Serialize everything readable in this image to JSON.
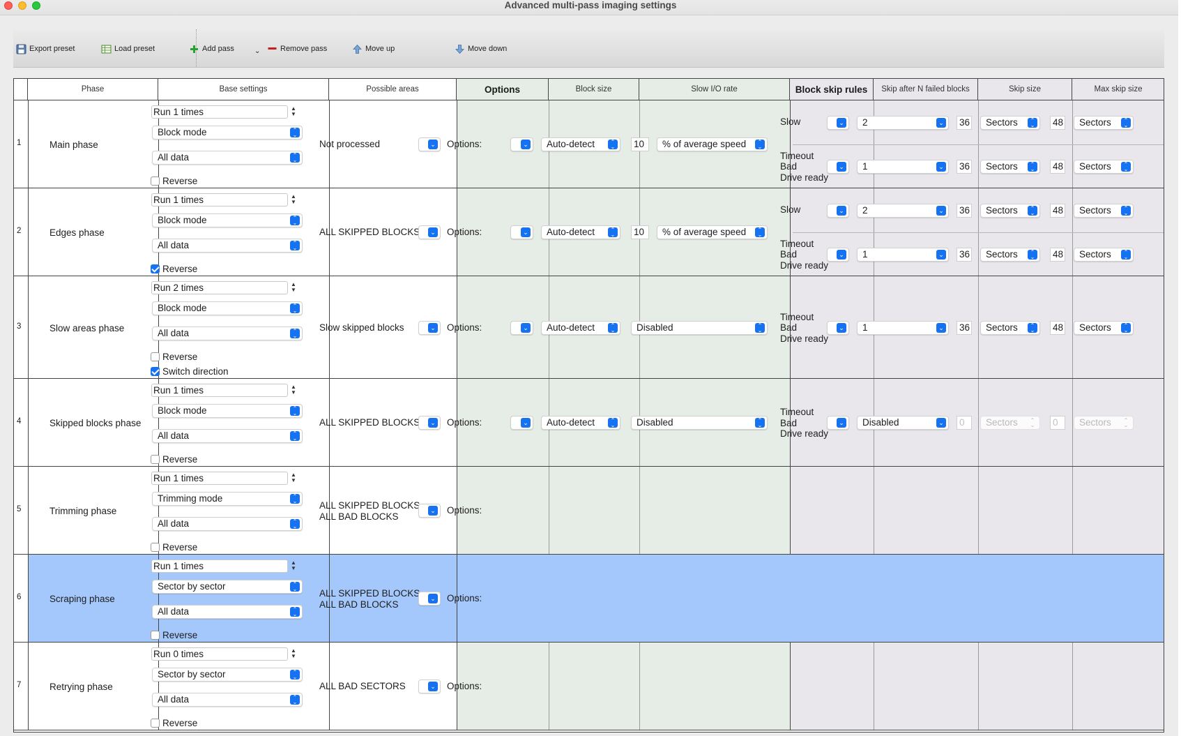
{
  "window": {
    "title": "Advanced multi-pass imaging settings"
  },
  "toolbar": {
    "export": "Export preset",
    "load": "Load preset",
    "add": "Add pass",
    "remove": "Remove pass",
    "up": "Move up",
    "down": "Move down"
  },
  "headers": {
    "phase": "Phase",
    "base": "Base settings",
    "areas": "Possible areas",
    "options": "Options",
    "block_size": "Block size",
    "slow_io": "Slow I/O rate",
    "skip_rules": "Block skip rules",
    "skip_after": "Skip after N failed blocks",
    "skip_size": "Skip size",
    "max_skip": "Max skip size"
  },
  "options_label": "Options:",
  "auto_detect": "Auto-detect",
  "speed_unit": "% of average speed",
  "disabled": "Disabled",
  "sectors": "Sectors",
  "reverse_label": "Reverse",
  "switch_label": "Switch direction",
  "rule_slow": "Slow",
  "rule_timeout": "Timeout\nBad\nDrive ready",
  "rows": [
    {
      "num": "1",
      "phase": "Main phase",
      "run": "Run 1 times",
      "mode": "Block mode",
      "data": "All data",
      "reverse": false,
      "area": "Not processed",
      "slow_io": "10",
      "rules": [
        {
          "after": "2",
          "skip": "36",
          "max": "48"
        },
        {
          "after": "1",
          "skip": "36",
          "max": "48"
        }
      ]
    },
    {
      "num": "2",
      "phase": "Edges phase",
      "run": "Run 1 times",
      "mode": "Block mode",
      "data": "All data",
      "reverse": true,
      "area": "ALL SKIPPED BLOCKS",
      "slow_io": "10",
      "rules": [
        {
          "after": "2",
          "skip": "36",
          "max": "48"
        },
        {
          "after": "1",
          "skip": "36",
          "max": "48"
        }
      ]
    },
    {
      "num": "3",
      "phase": "Slow areas phase",
      "run": "Run 2 times",
      "mode": "Block mode",
      "data": "All data",
      "reverse": false,
      "switch": true,
      "area": "Slow skipped blocks",
      "rules": [
        {
          "after": "1",
          "skip": "36",
          "max": "48"
        }
      ]
    },
    {
      "num": "4",
      "phase": "Skipped blocks phase",
      "run": "Run 1 times",
      "mode": "Block mode",
      "data": "All data",
      "reverse": false,
      "area": "ALL SKIPPED BLOCKS",
      "rules": [
        {
          "after": "Disabled",
          "skip": "0",
          "max": "0"
        }
      ]
    },
    {
      "num": "5",
      "phase": "Trimming phase",
      "run": "Run 1 times",
      "mode": "Trimming mode",
      "data": "All data",
      "reverse": false,
      "area": "ALL SKIPPED BLOCKS\nALL BAD BLOCKS"
    },
    {
      "num": "6",
      "phase": "Scraping phase",
      "run": "Run 1 times",
      "mode": "Sector by sector",
      "data": "All data",
      "reverse": false,
      "area": "ALL SKIPPED BLOCKS\nALL BAD BLOCKS",
      "selected": true
    },
    {
      "num": "7",
      "phase": "Retrying phase",
      "run": "Run 0 times",
      "mode": "Sector by sector",
      "data": "All data",
      "reverse": false,
      "area": "ALL BAD SECTORS"
    }
  ],
  "colors": {
    "selected": "#a4c8fb",
    "green": "#e6ece6",
    "purple": "#e9e7ec",
    "accent": "#1672f0"
  }
}
